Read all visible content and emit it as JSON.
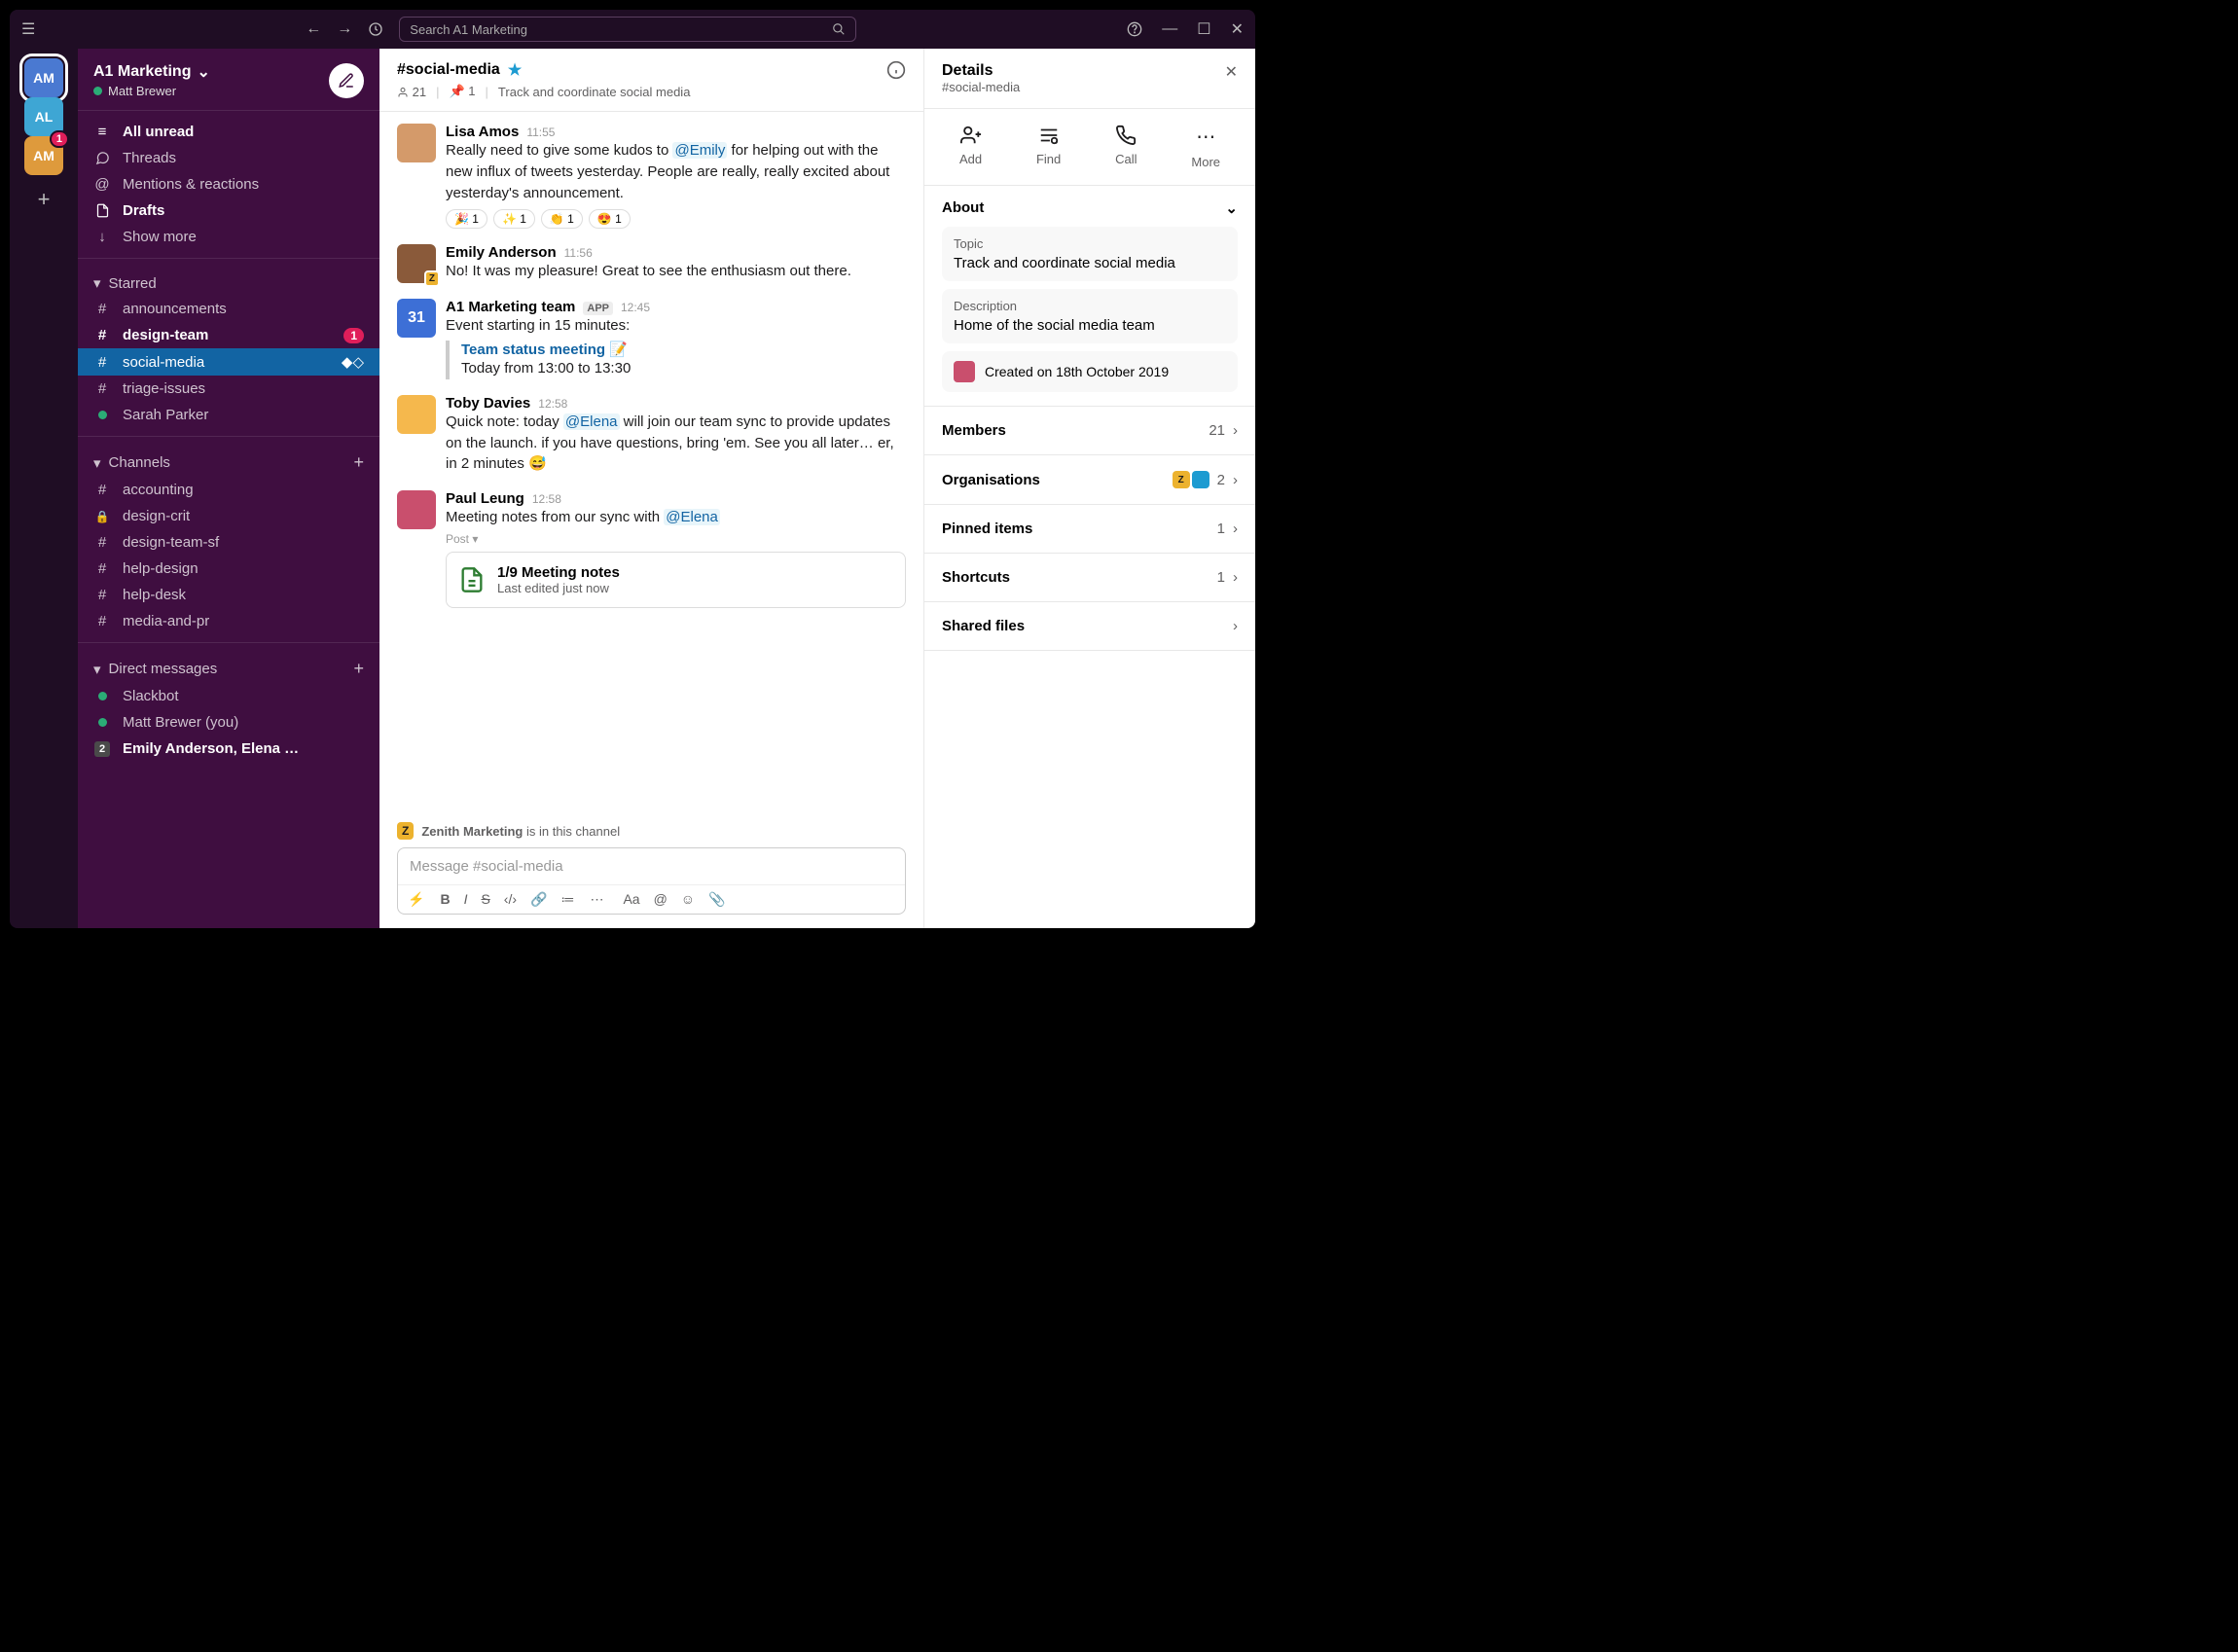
{
  "titlebar": {
    "search_placeholder": "Search A1 Marketing"
  },
  "rail": {
    "workspaces": [
      {
        "abbrev": "AM",
        "color": "#4a79d1",
        "active": true
      },
      {
        "abbrev": "AL",
        "color": "#3ea6d4",
        "active": false
      },
      {
        "807abbrev": "AM",
        "abbrev": "AM",
        "color": "#de9a3c",
        "active": false,
        "badge": "1"
      }
    ]
  },
  "sidebar": {
    "workspace": "A1 Marketing",
    "user": "Matt Brewer",
    "nav": {
      "all_unread": "All unread",
      "threads": "Threads",
      "mentions": "Mentions & reactions",
      "drafts": "Drafts",
      "show_more": "Show more"
    },
    "starred_label": "Starred",
    "starred": [
      {
        "name": "announcements",
        "prefix": "#"
      },
      {
        "name": "design-team",
        "prefix": "#",
        "bold": true,
        "badge": "1"
      },
      {
        "name": "social-media",
        "prefix": "#",
        "active": true
      },
      {
        "name": "triage-issues",
        "prefix": "#"
      },
      {
        "name": "Sarah Parker",
        "prefix": "presence"
      }
    ],
    "channels_label": "Channels",
    "channels": [
      {
        "name": "accounting",
        "prefix": "#"
      },
      {
        "name": "design-crit",
        "prefix": "lock"
      },
      {
        "name": "design-team-sf",
        "prefix": "#"
      },
      {
        "name": "help-design",
        "prefix": "#"
      },
      {
        "name": "help-desk",
        "prefix": "#"
      },
      {
        "name": "media-and-pr",
        "prefix": "#"
      }
    ],
    "dms_label": "Direct messages",
    "dms": [
      {
        "name": "Slackbot",
        "prefix": "presence"
      },
      {
        "name": "Matt Brewer (you)",
        "prefix": "presence"
      },
      {
        "name": "Emily Anderson, Elena …",
        "prefix": "count",
        "count": "2",
        "bold": true
      }
    ]
  },
  "channel": {
    "name": "#social-media",
    "members": "21",
    "pinned": "1",
    "topic": "Track and coordinate social media"
  },
  "messages": [
    {
      "author": "Lisa Amos",
      "time": "11:55",
      "avatar": "#d49a6a",
      "text_parts": [
        {
          "t": "Really need to give some kudos to "
        },
        {
          "t": "@Emily",
          "mention": true
        },
        {
          "t": " for helping out with the new influx of tweets yesterday. People are really, really excited about yesterday's announcement."
        }
      ],
      "reactions": [
        {
          "emoji": "🎉",
          "count": "1"
        },
        {
          "emoji": "✨",
          "count": "1"
        },
        {
          "emoji": "👏",
          "count": "1"
        },
        {
          "emoji": "😍",
          "count": "1"
        }
      ]
    },
    {
      "author": "Emily Anderson",
      "time": "11:56",
      "avatar": "#8a5a3a",
      "z": true,
      "text_parts": [
        {
          "t": "No! It was my pleasure! Great to see the enthusiasm out there."
        }
      ]
    },
    {
      "author": "A1 Marketing team",
      "time": "12:45",
      "avatar": "#3d6fd6",
      "app": true,
      "avatar_text": "31",
      "text_parts": [
        {
          "t": "Event starting in 15 minutes:"
        }
      ],
      "event": {
        "title": "Team status meeting 📝",
        "when": "Today from 13:00 to 13:30"
      }
    },
    {
      "author": "Toby Davies",
      "time": "12:58",
      "avatar": "#f5b84d",
      "text_parts": [
        {
          "t": "Quick note: today "
        },
        {
          "t": "@Elena",
          "mention": true
        },
        {
          "t": " will join our team sync to provide updates on the launch. if you have questions, bring 'em. See you all later… er, in 2 minutes 😅"
        }
      ]
    },
    {
      "author": "Paul Leung",
      "time": "12:58",
      "avatar": "#c94f6d",
      "text_parts": [
        {
          "t": "Meeting notes from our sync with "
        },
        {
          "t": "@Elena",
          "mention": true
        }
      ],
      "post": {
        "label": "Post ▾",
        "title": "1/9 Meeting notes",
        "sub": "Last edited just now"
      }
    }
  ],
  "notice": {
    "org": "Zenith Marketing",
    "suffix": " is in this channel"
  },
  "composer": {
    "placeholder": "Message #social-media"
  },
  "details": {
    "title": "Details",
    "subtitle": "#social-media",
    "actions": {
      "add": "Add",
      "find": "Find",
      "call": "Call",
      "more": "More"
    },
    "about_label": "About",
    "topic_label": "Topic",
    "topic": "Track and coordinate social media",
    "desc_label": "Description",
    "desc": "Home of the social media team",
    "created": "Created on 18th October 2019",
    "members_label": "Members",
    "members_count": "21",
    "orgs_label": "Organisations",
    "orgs_count": "2",
    "pinned_label": "Pinned items",
    "pinned_count": "1",
    "short_label": "Shortcuts",
    "short_count": "1",
    "files_label": "Shared files"
  }
}
